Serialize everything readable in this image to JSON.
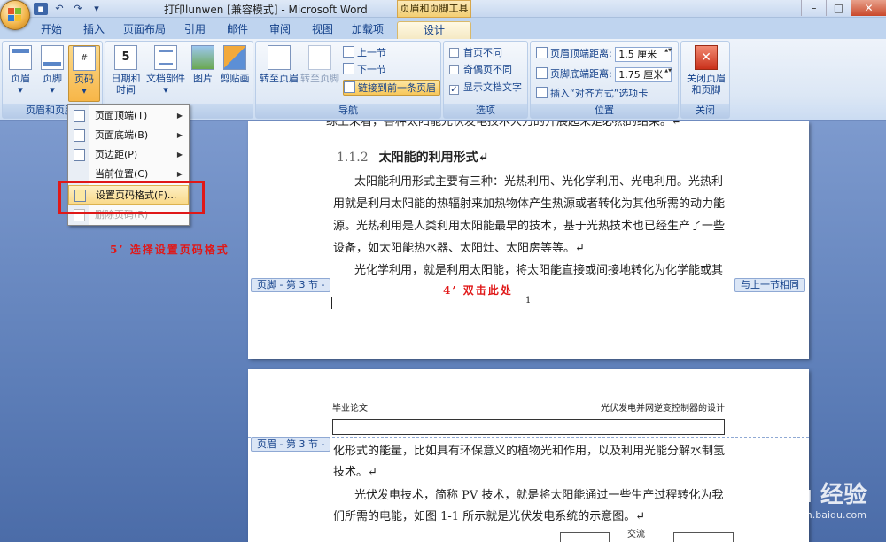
{
  "window": {
    "title": "打印lunwen [兼容模式] - Microsoft Word",
    "context_tool": "页眉和页脚工具"
  },
  "tabs": [
    "开始",
    "插入",
    "页面布局",
    "引用",
    "邮件",
    "审阅",
    "视图",
    "加载项",
    "设计"
  ],
  "ribbon": {
    "groups": {
      "header_footer": {
        "label": "页眉和页脚",
        "buttons": [
          "页眉",
          "页脚",
          "页码"
        ]
      },
      "insert": {
        "buttons": [
          "日期和\n时间",
          "文档部件",
          "图片",
          "剪贴画"
        ]
      },
      "navigation": {
        "label": "导航",
        "buttons": [
          "转至页眉",
          "转至页脚"
        ],
        "small": [
          "上一节",
          "下一节",
          "链接到前一条页眉"
        ]
      },
      "options": {
        "label": "选项",
        "items": [
          "首页不同",
          "奇偶页不同",
          "显示文档文字"
        ],
        "checked": [
          false,
          false,
          true
        ]
      },
      "position": {
        "label": "位置",
        "header_distance_label": "页眉顶端距离:",
        "header_distance": "1.5 厘米",
        "footer_distance_label": "页脚底端距离:",
        "footer_distance": "1.75 厘米",
        "align_tab": "插入“对齐方式”选项卡"
      },
      "close": {
        "label": "关闭",
        "button": "关闭页眉\n和页脚"
      }
    }
  },
  "menu": {
    "items": [
      {
        "label": "页面顶端(T)",
        "submenu": true
      },
      {
        "label": "页面底端(B)",
        "submenu": true
      },
      {
        "label": "页边距(P)",
        "submenu": true
      },
      {
        "label": "当前位置(C)",
        "submenu": true
      },
      {
        "label": "设置页码格式(F)...",
        "submenu": false
      },
      {
        "label": "删除页码(R)",
        "submenu": false
      }
    ]
  },
  "document": {
    "page1": {
      "line0": "综上来看，各种太阳能光伏发电技术大力的开展起来是必然的结果。↵",
      "heading_num": "1.1.2",
      "heading_text": "太阳能的利用形式↵",
      "para1": [
        "太阳能利用形式主要有三种：光热利用、光化学利用、光电利用。光热利",
        "用就是利用太阳能的热辐射来加热物体产生热源或者转化为其他所需的动力能",
        "源。光热利用是人类利用太阳能最早的技术，基于光热技术也已经生产了一些",
        "设备，如太阳能热水器、太阳灶、太阳房等等。↵"
      ],
      "para2": "光化学利用，就是利用太阳能，将太阳能直接或间接地转化为化学能或其",
      "footer_tag": "页脚 - 第 3 节 -",
      "same_as_prev": "与上一节相同",
      "page_number": "1"
    },
    "page2": {
      "header_left": "毕业论文",
      "header_right": "光伏发电并网逆变控制器的设计",
      "header_tag": "页眉 - 第 3 节 -",
      "lines": [
        "化形式的能量，比如具有环保意义的植物光和作用，以及利用光能分解水制氢",
        "技术。↵",
        "光伏发电技术，简称 PV 技术，就是将太阳能通过一些生产过程转化为我",
        "们所需的电能，如图 1-1 所示就是光伏发电系统的示意图。↵"
      ],
      "figure_label": "交流"
    }
  },
  "annotations": {
    "step4": "4’ 双击此处",
    "step5": "5’ 选择设置页码格式"
  },
  "watermark": {
    "brand": "Baidu 经验",
    "url": "jingyan.baidu.com"
  },
  "colors": {
    "accent": "#15428b",
    "highlight": "#f9d98a",
    "annotation": "#e01818"
  }
}
